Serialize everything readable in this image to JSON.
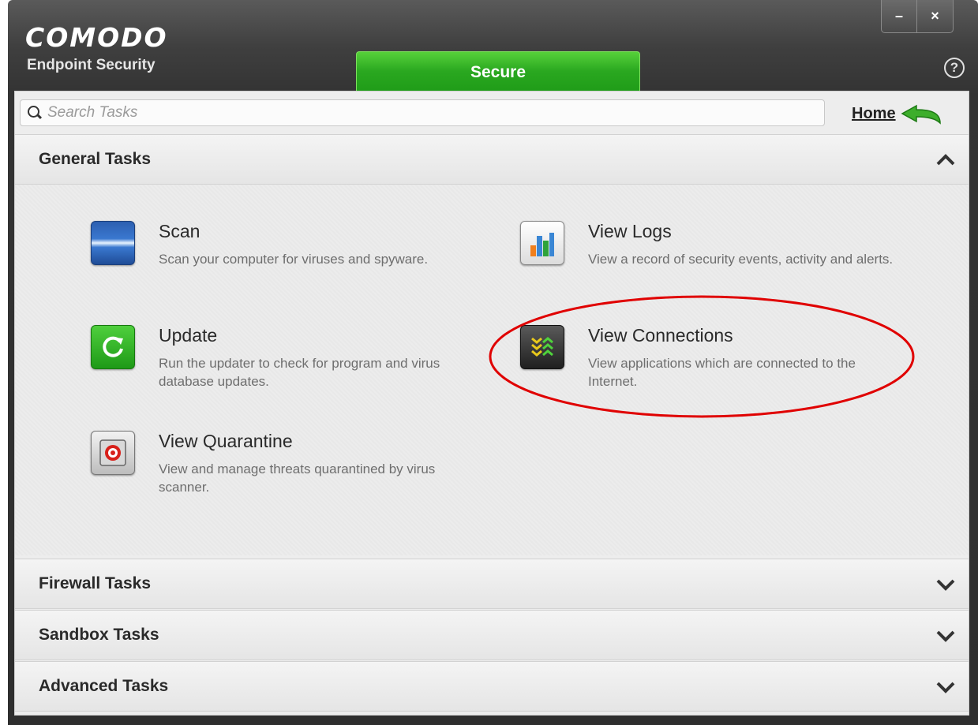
{
  "window": {
    "brand": "COMODO",
    "product": "Endpoint Security",
    "status_tab": "Secure",
    "minimize_label": "–",
    "close_label": "×",
    "help_label": "?"
  },
  "search": {
    "placeholder": "Search Tasks",
    "value": ""
  },
  "home": {
    "label": "Home"
  },
  "sections": {
    "general": {
      "title": "General Tasks",
      "expanded": true
    },
    "firewall": {
      "title": "Firewall Tasks",
      "expanded": false
    },
    "sandbox": {
      "title": "Sandbox Tasks",
      "expanded": false
    },
    "advanced": {
      "title": "Advanced Tasks",
      "expanded": false
    }
  },
  "tasks": {
    "scan": {
      "title": "Scan",
      "description": "Scan your computer for viruses and spyware.",
      "icon": "scan-icon"
    },
    "view_logs": {
      "title": "View Logs",
      "description": "View a record of security events, activity and alerts.",
      "icon": "bar-chart-icon"
    },
    "update": {
      "title": "Update",
      "description": "Run the updater to check for program and virus database updates.",
      "icon": "refresh-icon"
    },
    "view_connections": {
      "title": "View Connections",
      "description": "View applications which are connected to the Internet.",
      "icon": "connections-icon"
    },
    "view_quarantine": {
      "title": "View Quarantine",
      "description": "View and manage threats quarantined by virus scanner.",
      "icon": "quarantine-icon"
    }
  },
  "colors": {
    "status_green": "#2aa820",
    "highlight_red": "#e00000",
    "chrome_dark": "#3f3f3f"
  }
}
